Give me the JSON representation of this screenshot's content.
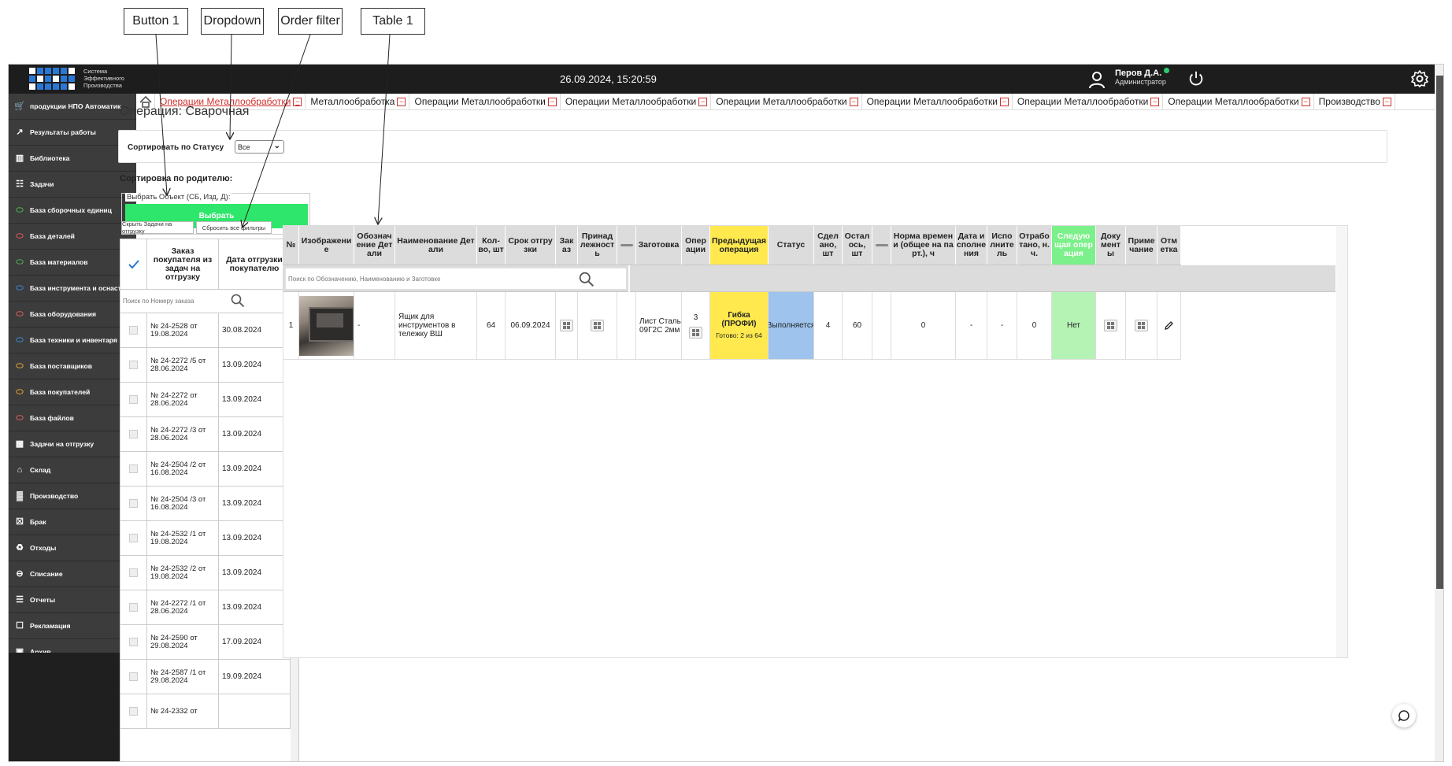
{
  "annotations": {
    "button1": "Button 1",
    "dropdown": "Dropdown",
    "order_filter": "Order filter",
    "table1": "Table 1"
  },
  "header": {
    "logo_text": "Система Эффективного Производства",
    "datetime": "26.09.2024, 15:20:59",
    "user_name": "Перов Д.А.",
    "user_role": "Администратор"
  },
  "sidebar": {
    "items": [
      {
        "label": "продукции НПО Автоматик",
        "icon": "cart-icon"
      },
      {
        "label": "Результаты работы",
        "icon": "rocket-icon"
      },
      {
        "label": "Библиотека",
        "icon": "books-icon"
      },
      {
        "label": "Задачи",
        "icon": "tasks-icon"
      },
      {
        "label": "База сборочных единиц",
        "icon": "database-icon"
      },
      {
        "label": "База деталей",
        "icon": "database-icon"
      },
      {
        "label": "База материалов",
        "icon": "database-icon"
      },
      {
        "label": "База инструмента и оснастки",
        "icon": "database-icon"
      },
      {
        "label": "База оборудования",
        "icon": "database-icon"
      },
      {
        "label": "База техники и инвентаря",
        "icon": "database-icon"
      },
      {
        "label": "База поставщиков",
        "icon": "database-icon"
      },
      {
        "label": "База покупателей",
        "icon": "database-icon"
      },
      {
        "label": "База файлов",
        "icon": "database-icon"
      },
      {
        "label": "Задачи на отгрузку",
        "icon": "calendar-icon"
      },
      {
        "label": "Склад",
        "icon": "warehouse-icon"
      },
      {
        "label": "Производство",
        "icon": "factory-icon"
      },
      {
        "label": "Брак",
        "icon": "trash-icon"
      },
      {
        "label": "Отходы",
        "icon": "recycle-icon"
      },
      {
        "label": "Списание",
        "icon": "minus-circle-icon"
      },
      {
        "label": "Отчеты",
        "icon": "report-icon"
      },
      {
        "label": "Рекламация",
        "icon": "claim-icon"
      },
      {
        "label": "Архив",
        "icon": "archive-icon"
      }
    ]
  },
  "tabs": [
    {
      "label": "Операции Металлообработки",
      "active": true
    },
    {
      "label": "Металлообработка",
      "active": false
    },
    {
      "label": "Операции Металлообработки",
      "active": false
    },
    {
      "label": "Операции Металлообработки",
      "active": false
    },
    {
      "label": "Операции Металлообработки",
      "active": false
    },
    {
      "label": "Операции Металлообработки",
      "active": false
    },
    {
      "label": "Операции Металлообработки",
      "active": false
    },
    {
      "label": "Операции Металлообработки",
      "active": false
    },
    {
      "label": "Производство",
      "active": false
    }
  ],
  "page": {
    "title": "Операция: Сварочная",
    "status_filter_label": "Сортировать по Статусу",
    "status_filter_value": "Все",
    "parent_sort_title": "Сортировка по родителю:",
    "select_object_legend": "Выбрать Объект (СБ, Изд, Д):",
    "select_button": "Выбрать",
    "hide_tasks_button": "Скрыть Задачи на отгрузку",
    "reset_filters_button": "Сбросить все фильтры"
  },
  "orders": {
    "headers": [
      "Заказ покупателя из задач на отгрузку",
      "Дата отгрузки покупателю"
    ],
    "search_placeholder": "Поиск по Номеру заказа",
    "rows": [
      {
        "order": "№ 24-2528 от 19.08.2024",
        "date": "30.08.2024"
      },
      {
        "order": "№ 24-2272 /5 от 28.06.2024",
        "date": "13.09.2024"
      },
      {
        "order": "№ 24-2272 от 28.06.2024",
        "date": "13.09.2024"
      },
      {
        "order": "№ 24-2272 /3 от 28.06.2024",
        "date": "13.09.2024"
      },
      {
        "order": "№ 24-2504 /2 от 16.08.2024",
        "date": "13.09.2024"
      },
      {
        "order": "№ 24-2504 /3 от 16.08.2024",
        "date": "13.09.2024"
      },
      {
        "order": "№ 24-2532 /1 от 19.08.2024",
        "date": "13.09.2024"
      },
      {
        "order": "№ 24-2532 /2 от 19.08.2024",
        "date": "13.09.2024"
      },
      {
        "order": "№ 24-2272 /1 от 28.06.2024",
        "date": "13.09.2024"
      },
      {
        "order": "№ 24-2590 от 29.08.2024",
        "date": "17.09.2024"
      },
      {
        "order": "№ 24-2587 /1 от 29.08.2024",
        "date": "19.09.2024"
      },
      {
        "order": "№ 24-2332 от",
        "date": ""
      }
    ]
  },
  "main_table": {
    "headers": [
      "№",
      "Изображени е",
      "Обознач ение Дет али",
      "Наименование Дет али",
      "Кол-во, шт",
      "Срок отгру зки",
      "Зак аз",
      "Принад лежност ь",
      "",
      "Заготовка",
      "Опер ации",
      "Предыдущая операция",
      "Статус",
      "Сдел ано, шт",
      "Остал ось, шт",
      "",
      "Норма времен и (общее на па рт.), ч",
      "Дата и сполне ния",
      "Испо лните ль",
      "Отрабо тано, н. ч.",
      "Следую щая опер ация",
      "Доку мент ы",
      "Приме чание",
      "Отм етка"
    ],
    "search_placeholder": "Поиск по Обозначению, Наименованию и Заготовке",
    "rows": [
      {
        "num": "1",
        "designation": "-",
        "name": "Ящик для инструментов в тележку ВШ",
        "qty": "64",
        "ship_date": "06.09.2024",
        "blank": "Лист Сталь 09Г2С 2мм",
        "operations_count": "3",
        "prev_operation": "Гибка (ПРОФИ)",
        "prev_operation_progress": "Готово: 2 из 64",
        "status": "Выполняется",
        "done": "4",
        "remaining": "60",
        "time_norm": "0",
        "exec_date": "-",
        "executor": "-",
        "worked": "0",
        "next_operation": "Нет"
      }
    ]
  },
  "colors": {
    "topbar": "#1d1d1d",
    "sidebar": "#3c3c3c",
    "select_button": "#2ee66b",
    "prev_operation": "#ffe94f",
    "status_in_progress": "#9ec3ec",
    "next_operation": "#b4f3b4",
    "active_tab": "#d0312d"
  }
}
